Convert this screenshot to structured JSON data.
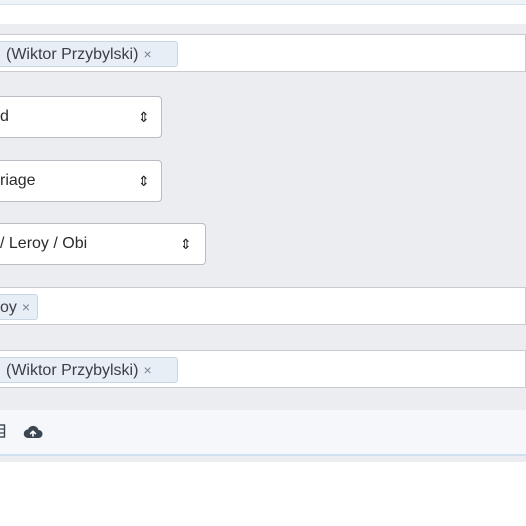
{
  "rows": [
    {
      "type": "tags",
      "tags": [
        {
          "label": "(Wiktor Przybylski)",
          "remove": "×"
        }
      ]
    },
    {
      "type": "select",
      "value": "d",
      "caret": "⇕"
    },
    {
      "type": "select",
      "value": "riage",
      "caret": "⇕"
    },
    {
      "type": "select",
      "value": "/ Leroy / Obi",
      "caret": "⇕"
    },
    {
      "type": "tags",
      "tags": [
        {
          "label": "oy",
          "remove": "×"
        }
      ]
    },
    {
      "type": "tags",
      "tags": [
        {
          "label": "(Wiktor Przybylski)",
          "remove": "×"
        }
      ]
    }
  ],
  "toolbar": {
    "icons": [
      "table-icon",
      "cloud-upload-icon"
    ]
  },
  "colors": {
    "panel_background": "#ecedf1",
    "tag_background": "#e8eef5",
    "toolbar_border": "#cfe0f0"
  }
}
